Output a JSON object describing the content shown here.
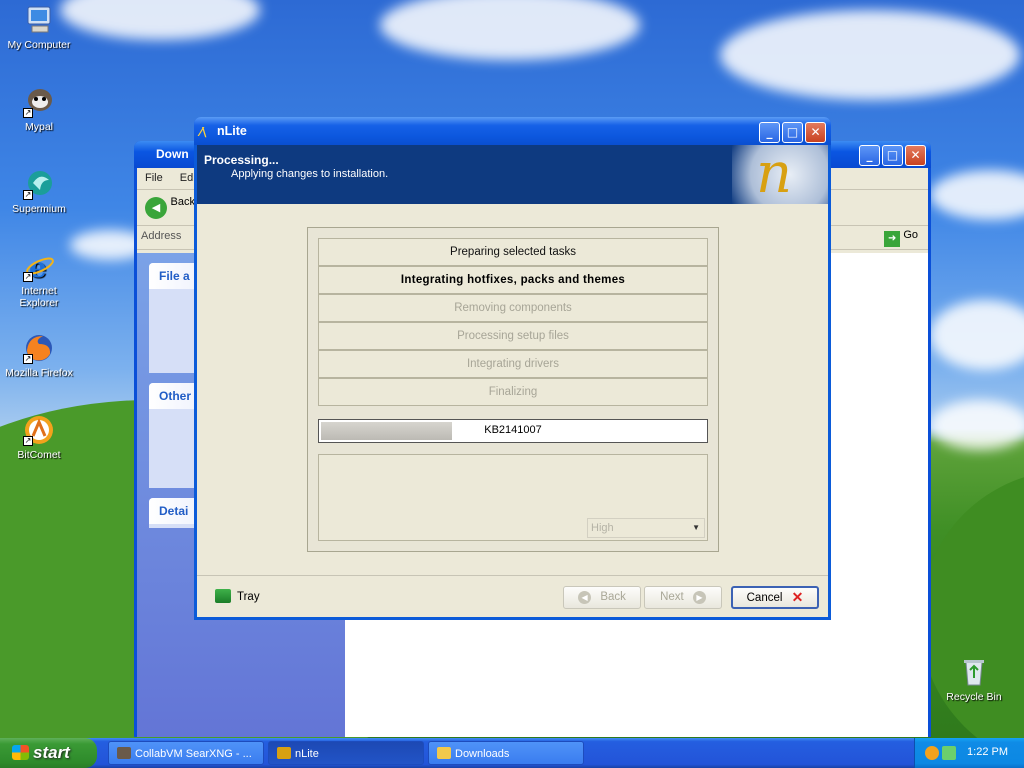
{
  "desktop": {
    "icons": [
      {
        "label": "My Computer"
      },
      {
        "label": "Mypal"
      },
      {
        "label": "Supermium"
      },
      {
        "label": "Internet Explorer"
      },
      {
        "label": "Mozilla Firefox"
      },
      {
        "label": "BitComet"
      },
      {
        "label": "Recycle Bin"
      }
    ]
  },
  "explorer": {
    "title": "Down",
    "menu": [
      "File",
      "Edi"
    ],
    "back_label": "Back",
    "address_label": "Address",
    "go_label": "Go",
    "panels": [
      "File a",
      "Other",
      "Detai"
    ]
  },
  "nlite": {
    "title": "nLite",
    "header_title": "Processing...",
    "header_subtitle": "Applying changes to installation.",
    "tasks": [
      {
        "label": "Preparing selected tasks",
        "state": "done"
      },
      {
        "label": "Integrating hotfixes, packs and themes",
        "state": "active"
      },
      {
        "label": "Removing components",
        "state": "pending"
      },
      {
        "label": "Processing setup files",
        "state": "pending"
      },
      {
        "label": "Integrating drivers",
        "state": "pending"
      },
      {
        "label": "Finalizing",
        "state": "pending"
      }
    ],
    "progress": {
      "label": "KB2141007",
      "fraction": 0.34
    },
    "priority": "High",
    "tray_label": "Tray",
    "back_label": "Back",
    "next_label": "Next",
    "cancel_label": "Cancel"
  },
  "taskbar": {
    "start_label": "start",
    "items": [
      {
        "label": "CollabVM SearXNG - ..."
      },
      {
        "label": "nLite"
      },
      {
        "label": "Downloads"
      }
    ],
    "clock": "1:22 PM"
  }
}
